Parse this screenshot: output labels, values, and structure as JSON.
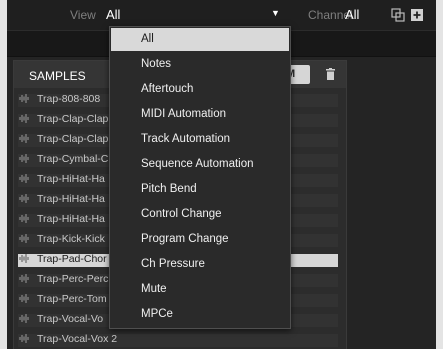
{
  "topbar": {
    "view_label": "View",
    "view_value": "All",
    "channel_label": "Channel",
    "channel_value": "All",
    "icons": [
      "overlay-icon",
      "add-icon"
    ]
  },
  "samples_panel": {
    "title": "SAMPLES",
    "cam_button_label": "AM",
    "samples": [
      {
        "label": "Trap-808-808",
        "selected": false
      },
      {
        "label": "Trap-Clap-Clap",
        "selected": false
      },
      {
        "label": "Trap-Clap-Clap",
        "selected": false
      },
      {
        "label": "Trap-Cymbal-C",
        "selected": false
      },
      {
        "label": "Trap-HiHat-Ha",
        "selected": false
      },
      {
        "label": "Trap-HiHat-Ha",
        "selected": false
      },
      {
        "label": "Trap-HiHat-Ha",
        "selected": false
      },
      {
        "label": "Trap-Kick-Kick",
        "selected": false
      },
      {
        "label": "Trap-Pad-Chor",
        "selected": true
      },
      {
        "label": "Trap-Perc-Perc",
        "selected": false
      },
      {
        "label": "Trap-Perc-Tom",
        "selected": false
      },
      {
        "label": "Trap-Vocal-Vo",
        "selected": false
      },
      {
        "label": "Trap-Vocal-Vox 2",
        "selected": false
      }
    ]
  },
  "view_dropdown": {
    "selected": "All",
    "options": [
      "All",
      "Notes",
      "Aftertouch",
      "MIDI Automation",
      "Track Automation",
      "Sequence Automation",
      "Pitch Bend",
      "Control Change",
      "Program Change",
      "Ch Pressure",
      "Mute",
      "MPCe"
    ]
  },
  "colors": {
    "background": "#242424",
    "selected_highlight": "#d9d9d9",
    "text": "#d8d8d8"
  }
}
